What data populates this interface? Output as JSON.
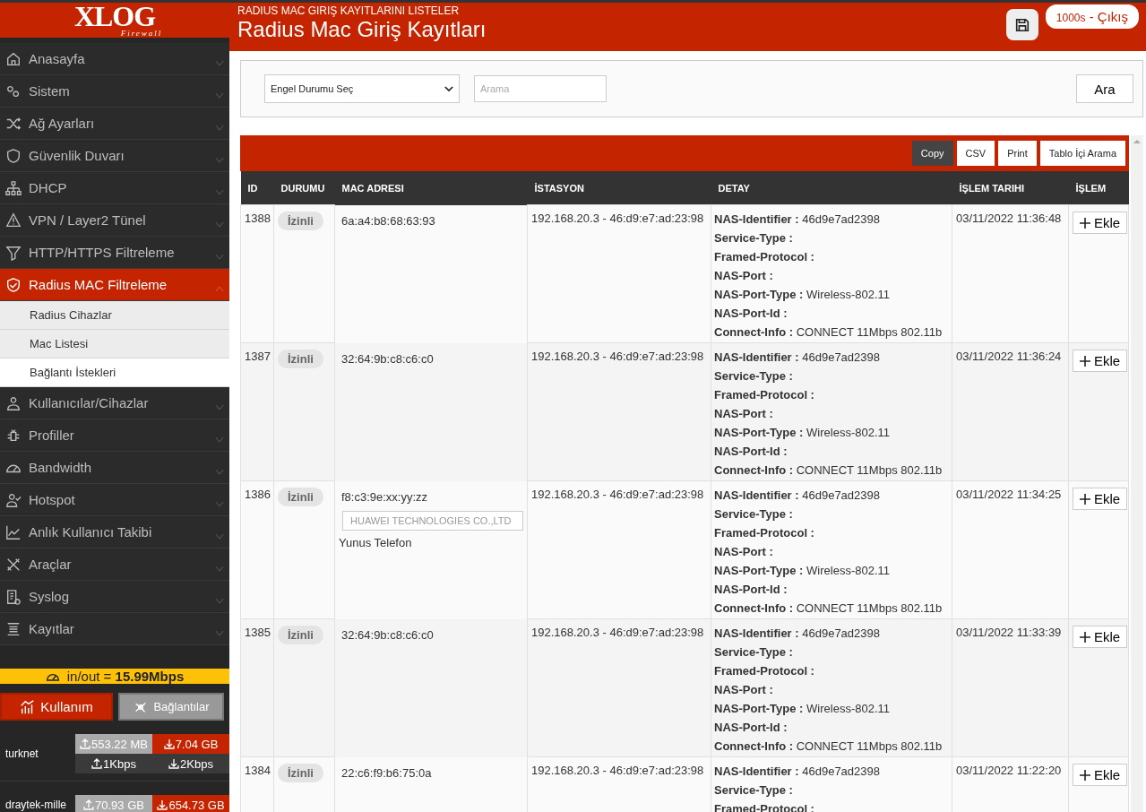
{
  "brand": {
    "logo": "XLOG",
    "tagline": "Firewall"
  },
  "sidebar": {
    "items": [
      {
        "label": "Anasayfa",
        "selected": false,
        "expanded": false
      },
      {
        "label": "Sistem",
        "selected": false,
        "expanded": false
      },
      {
        "label": "Ağ Ayarları",
        "selected": false,
        "expanded": false
      },
      {
        "label": "Güvenlik Duvarı",
        "selected": false,
        "expanded": false
      },
      {
        "label": "DHCP",
        "selected": false,
        "expanded": false
      },
      {
        "label": "VPN / Layer2 Tünel",
        "selected": false,
        "expanded": false
      },
      {
        "label": "HTTP/HTTPS Filtreleme",
        "selected": false,
        "expanded": false
      },
      {
        "label": "Radius MAC Filtreleme",
        "selected": true,
        "expanded": true,
        "children": [
          {
            "label": "Radius Cihazlar",
            "selected": false
          },
          {
            "label": "Mac Listesi",
            "selected": false
          },
          {
            "label": "Bağlantı İstekleri",
            "selected": true
          }
        ]
      },
      {
        "label": "Kullanıcılar/Cihazlar",
        "selected": false,
        "expanded": false
      },
      {
        "label": "Profiller",
        "selected": false,
        "expanded": false
      },
      {
        "label": "Bandwidth",
        "selected": false,
        "expanded": false
      },
      {
        "label": "Hotspot",
        "selected": false,
        "expanded": false
      },
      {
        "label": "Anlık Kullanıcı Takibi",
        "selected": false,
        "expanded": false
      },
      {
        "label": "Araçlar",
        "selected": false,
        "expanded": false
      },
      {
        "label": "Syslog",
        "selected": false,
        "expanded": false
      },
      {
        "label": "Kayıtlar",
        "selected": false,
        "expanded": false
      }
    ],
    "throughput": {
      "label": "in/out = ",
      "value": "15.99Mbps"
    },
    "tabs": [
      {
        "label": "Kullanım",
        "selected": true
      },
      {
        "label": "Bağlantılar",
        "selected": false
      }
    ],
    "links": [
      {
        "name": "turknet",
        "upload_total": "553.22 MB",
        "download_total": "7.04 GB",
        "upload_rate": "1Kbps",
        "download_rate": "2Kbps"
      },
      {
        "name": "draytek-mille",
        "upload_total": "70.93 GB",
        "download_total": "654.73 GB"
      }
    ]
  },
  "header": {
    "subtitle": "RADIUS MAC GIRIŞ KAYITLARINI LISTELER",
    "title": "Radius Mac Giriş Kayıtları",
    "timer": "1000s",
    "logout": "- Çıkış"
  },
  "filter": {
    "select": "Engel Durumu Seç",
    "search_placeholder": "Arama",
    "button": "Ara"
  },
  "table": {
    "tools": [
      {
        "label": "Copy",
        "selected": true
      },
      {
        "label": "CSV",
        "selected": false
      },
      {
        "label": "Print",
        "selected": false
      },
      {
        "label": "Tablo İçi Arama",
        "selected": false
      }
    ],
    "columns": [
      "ID",
      "DURUMU",
      "MAC ADRESI",
      "İSTASYON",
      "DETAY",
      "İŞLEM TARIHI",
      "İŞLEM"
    ],
    "rows": [
      {
        "id": "1388",
        "status": "İzinli",
        "mac": "6a:a4:b8:68:63:93",
        "station": "192.168.20.3 - 46:d9:e7:ad:23:98",
        "detail": [
          {
            "key": "NAS-Identifier :",
            "value": "46d9e7ad2398"
          },
          {
            "key": "Service-Type :"
          },
          {
            "key": "Framed-Protocol :"
          },
          {
            "key": "NAS-Port :"
          },
          {
            "key": "NAS-Port-Type :",
            "value": "Wireless-802.11"
          },
          {
            "key": "NAS-Port-Id :"
          },
          {
            "key": "Connect-Info :",
            "value": "CONNECT 11Mbps 802.11b"
          }
        ],
        "date": "03/11/2022 11:36:48",
        "action": "Ekle"
      },
      {
        "id": "1387",
        "status": "İzinli",
        "mac": "32:64:9b:c8:c6:c0",
        "station": "192.168.20.3 - 46:d9:e7:ad:23:98",
        "detail": [
          {
            "key": "NAS-Identifier :",
            "value": "46d9e7ad2398"
          },
          {
            "key": "Service-Type :"
          },
          {
            "key": "Framed-Protocol :"
          },
          {
            "key": "NAS-Port :"
          },
          {
            "key": "NAS-Port-Type :",
            "value": "Wireless-802.11"
          },
          {
            "key": "NAS-Port-Id :"
          },
          {
            "key": "Connect-Info :",
            "value": "CONNECT 11Mbps 802.11b"
          }
        ],
        "date": "03/11/2022 11:36:24",
        "action": "Ekle"
      },
      {
        "id": "1386",
        "status": "İzinli",
        "mac": "f8:c3:9e:xx:yy:zz",
        "vendor": "HUAWEI TECHNOLOGIES CO.,LTD",
        "note": "Yunus Telefon",
        "station": "192.168.20.3 - 46:d9:e7:ad:23:98",
        "detail": [
          {
            "key": "NAS-Identifier :",
            "value": "46d9e7ad2398"
          },
          {
            "key": "Service-Type :"
          },
          {
            "key": "Framed-Protocol :"
          },
          {
            "key": "NAS-Port :"
          },
          {
            "key": "NAS-Port-Type :",
            "value": "Wireless-802.11"
          },
          {
            "key": "NAS-Port-Id :"
          },
          {
            "key": "Connect-Info :",
            "value": "CONNECT 11Mbps 802.11b"
          }
        ],
        "date": "03/11/2022 11:34:25",
        "action": "Ekle"
      },
      {
        "id": "1385",
        "status": "İzinli",
        "mac": "32:64:9b:c8:c6:c0",
        "station": "192.168.20.3 - 46:d9:e7:ad:23:98",
        "detail": [
          {
            "key": "NAS-Identifier :",
            "value": "46d9e7ad2398"
          },
          {
            "key": "Service-Type :"
          },
          {
            "key": "Framed-Protocol :"
          },
          {
            "key": "NAS-Port :"
          },
          {
            "key": "NAS-Port-Type :",
            "value": "Wireless-802.11"
          },
          {
            "key": "NAS-Port-Id :"
          },
          {
            "key": "Connect-Info :",
            "value": "CONNECT 11Mbps 802.11b"
          }
        ],
        "date": "03/11/2022 11:33:39",
        "action": "Ekle"
      },
      {
        "id": "1384",
        "status": "İzinli",
        "mac": "22:c6:f9:b6:75:0a",
        "station": "192.168.20.3 - 46:d9:e7:ad:23:98",
        "detail": [
          {
            "key": "NAS-Identifier :",
            "value": "46d9e7ad2398"
          },
          {
            "key": "Service-Type :"
          },
          {
            "key": "Framed-Protocol :"
          }
        ],
        "date": "03/11/2022 11:22:20",
        "action": "Ekle"
      }
    ]
  }
}
